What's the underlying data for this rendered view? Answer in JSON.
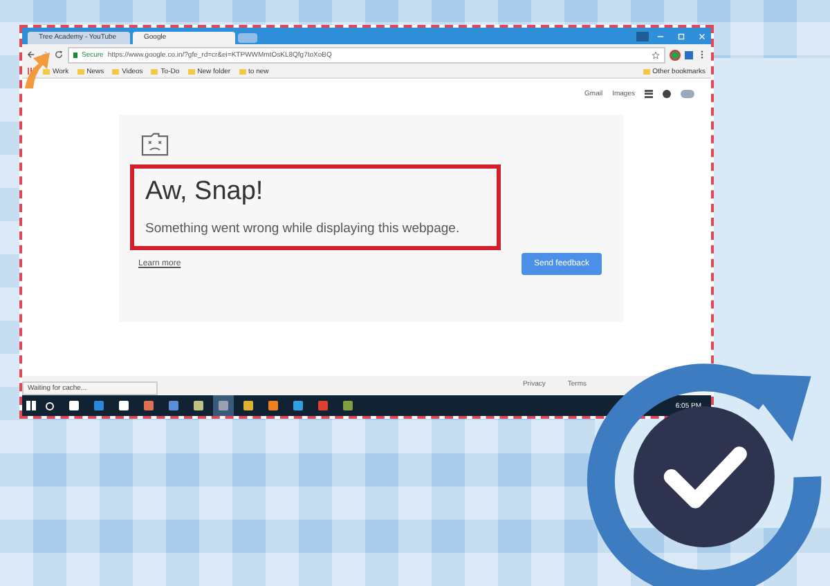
{
  "browser": {
    "tabs": [
      {
        "title": "Tree Academy - YouTube",
        "selected": false
      },
      {
        "title": "Google",
        "selected": true
      }
    ],
    "address": {
      "secure_label": "Secure",
      "url": "https://www.google.co.in/?gfe_rd=cr&ei=KTPWWMmtOsKL8Qfg7toXoBQ"
    },
    "bookmarks": [
      "Work",
      "News",
      "Videos",
      "To-Do",
      "New folder",
      "to new"
    ],
    "other_bookmarks": "Other bookmarks"
  },
  "google_header": {
    "links": [
      "Gmail",
      "Images"
    ]
  },
  "error_page": {
    "title": "Aw, Snap!",
    "message": "Something went wrong while displaying this webpage.",
    "learn_more": "Learn more",
    "button": "Send feedback"
  },
  "footer": {
    "right_links": [
      "Privacy",
      "Terms"
    ]
  },
  "status_bar": "Waiting for cache...",
  "taskbar": {
    "time": "6:05 PM"
  }
}
